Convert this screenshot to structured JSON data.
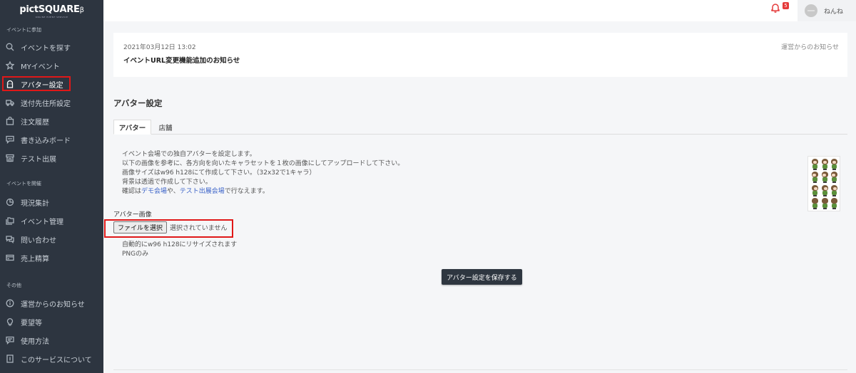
{
  "logo": {
    "main": "pictSQUARE",
    "suffix": "β",
    "sub": "ONLINE EVENT SERVICE"
  },
  "sidebar": {
    "section1": "イベントに参加",
    "section2": "イベントを開催",
    "section3": "その他",
    "items": [
      {
        "label": "イベントを探す",
        "icon": "search-icon"
      },
      {
        "label": "MYイベント",
        "icon": "star-icon"
      },
      {
        "label": "アバター設定",
        "icon": "ghost-icon"
      },
      {
        "label": "送付先住所設定",
        "icon": "truck-icon"
      },
      {
        "label": "注文履歴",
        "icon": "bag-icon"
      },
      {
        "label": "書き込みボード",
        "icon": "chat-icon"
      },
      {
        "label": "テスト出展",
        "icon": "store-icon"
      },
      {
        "label": "現況集計",
        "icon": "pie-icon"
      },
      {
        "label": "イベント管理",
        "icon": "folders-icon"
      },
      {
        "label": "問い合わせ",
        "icon": "comments-icon"
      },
      {
        "label": "売上精算",
        "icon": "card-icon"
      },
      {
        "label": "運営からのお知らせ",
        "icon": "info-icon"
      },
      {
        "label": "要望等",
        "icon": "lightbulb-icon"
      },
      {
        "label": "使用方法",
        "icon": "message-icon"
      },
      {
        "label": "このサービスについて",
        "icon": "document-icon"
      }
    ]
  },
  "header": {
    "badge": "5",
    "user_name": "ねんね"
  },
  "notice": {
    "date": "2021年03月12日 13:02",
    "title": "イベントURL変更機能追加のお知らせ",
    "link": "運営からのお知らせ"
  },
  "main": {
    "title": "アバター設定",
    "tabs": [
      {
        "label": "アバター"
      },
      {
        "label": "店舗"
      }
    ],
    "desc": {
      "line1": "イベント会場での独自アバターを設定します。",
      "line2": "以下の画像を参考に、各方向を向いたキャラセットを１枚の画像にしてアップロードして下さい。",
      "line3": "画像サイズはw96 h128にて作成して下さい。（32x32で1キャラ）",
      "line4": "背景は透過で作成して下さい。",
      "line5_prefix": "確認は",
      "link_demo": "デモ会場",
      "line5_mid": "や、",
      "link_test": "テスト出展会場",
      "line5_suffix": "で行なえます。"
    },
    "avatar_image_label": "アバター画像",
    "file_button": "ファイルを選択",
    "file_status": "選択されていません",
    "hint1": "自動的にw96 h128にリサイズされます",
    "hint2": "PNGのみ",
    "save_button": "アバター設定を保存する"
  },
  "colors": {
    "sidebar_bg": "#2d3540",
    "highlight": "#e01818",
    "link": "#3a62c8",
    "bell": "#e53b3b"
  }
}
